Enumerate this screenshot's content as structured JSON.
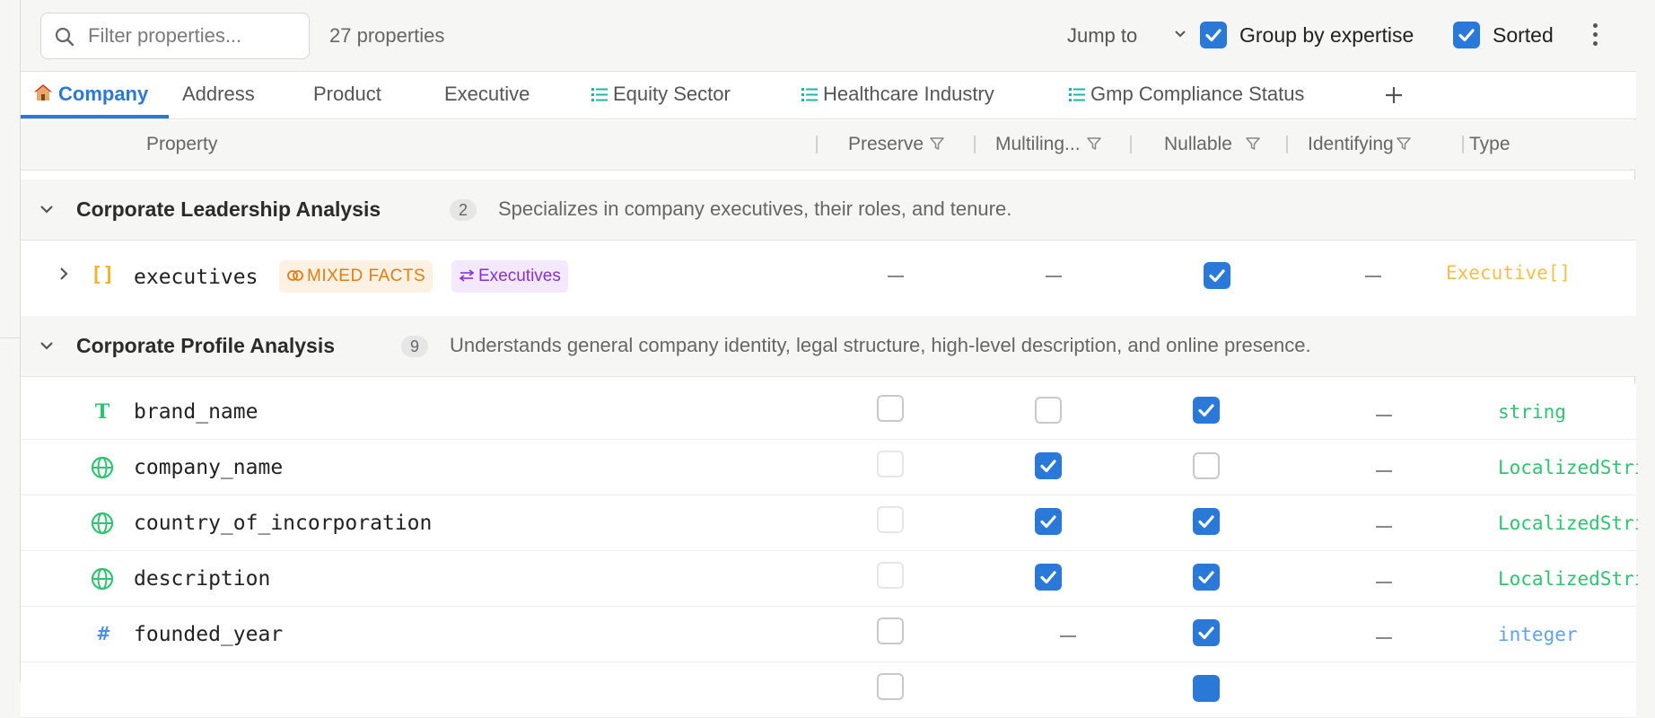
{
  "toolbar": {
    "search_placeholder": "Filter properties...",
    "property_count": "27 properties",
    "jump_to": "Jump to",
    "group_by_expertise": "Group by expertise",
    "group_by_expertise_checked": true,
    "sorted": "Sorted",
    "sorted_checked": true
  },
  "tabs": [
    {
      "label": "Company",
      "icon": "house-icon",
      "active": true
    },
    {
      "label": "Address",
      "icon": "",
      "active": false
    },
    {
      "label": "Product",
      "icon": "",
      "active": false
    },
    {
      "label": "Executive",
      "icon": "",
      "active": false
    },
    {
      "label": "Equity Sector",
      "icon": "list-icon",
      "active": false
    },
    {
      "label": "Healthcare Industry",
      "icon": "list-icon",
      "active": false
    },
    {
      "label": "Gmp Compliance Status",
      "icon": "list-icon",
      "active": false
    }
  ],
  "columns": {
    "property": "Property",
    "preserve": "Preserve",
    "multilingual": "Multiling...",
    "nullable": "Nullable",
    "identifying": "Identifying",
    "type": "Type"
  },
  "groups": [
    {
      "title": "Corporate Leadership Analysis",
      "count": "2",
      "description": "Specializes in company executives, their roles, and tenure."
    },
    {
      "title": "Corporate Profile Analysis",
      "count": "9",
      "description": "Understands general company identity, legal structure, high-level description, and online presence."
    }
  ],
  "rows": [
    {
      "name": "executives",
      "icon": "array-icon",
      "badges": [
        "MIXED FACTS",
        "Executives"
      ],
      "preserve": "dash",
      "multilingual": "dash",
      "nullable": "checked",
      "identifying": "dash",
      "type": "Executive[]",
      "type_color": "#f5c04a"
    },
    {
      "name": "brand_name",
      "icon": "text-type-icon",
      "preserve": "unchecked",
      "multilingual": "unchecked",
      "nullable": "checked",
      "identifying": "dash",
      "type": "string",
      "type_color": "#2fc46f"
    },
    {
      "name": "company_name",
      "icon": "globe-icon",
      "preserve": "faint",
      "multilingual": "checked",
      "nullable": "unchecked",
      "identifying": "dash",
      "type": "LocalizedString",
      "type_color": "#2fc46f"
    },
    {
      "name": "country_of_incorporation",
      "icon": "globe-icon",
      "preserve": "faint",
      "multilingual": "checked",
      "nullable": "checked",
      "identifying": "dash",
      "type": "LocalizedString",
      "type_color": "#2fc46f"
    },
    {
      "name": "description",
      "icon": "globe-icon",
      "preserve": "faint",
      "multilingual": "checked",
      "nullable": "checked",
      "identifying": "dash",
      "type": "LocalizedString",
      "type_color": "#2fc46f"
    },
    {
      "name": "founded_year",
      "icon": "hash-icon",
      "preserve": "unchecked",
      "multilingual": "dash",
      "nullable": "checked",
      "identifying": "dash",
      "type": "integer",
      "type_color": "#5aa4f0"
    }
  ],
  "colors": {
    "accent": "#2a79d9",
    "mixed_facts": "#e57c10",
    "executives_badge": "#8a2fd6"
  }
}
